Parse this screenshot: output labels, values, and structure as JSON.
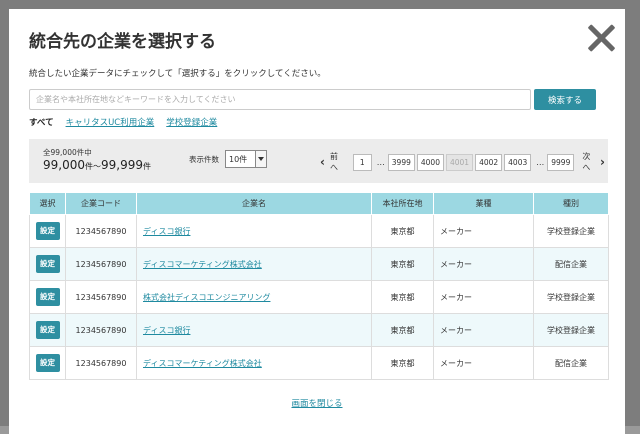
{
  "modal": {
    "title": "統合先の企業を選択する",
    "description": "統合したい企業データにチェックして「選択する」をクリックしてください。",
    "search": {
      "placeholder": "企業名や本社所在地などキーワードを入力してください",
      "button_label": "検索する"
    },
    "filters": {
      "all": "すべて",
      "careertasu": "キャリタスUC利用企業",
      "school": "学校登録企業"
    },
    "summary": {
      "total_label": "全99,000件中",
      "range_start": "99,000",
      "range_start_unit": "件～",
      "range_end": "99,999",
      "range_end_unit": "件",
      "per_page_label": "表示件数",
      "per_page_value": "10件"
    },
    "pager": {
      "prev_icon": "chevron-left-icon",
      "prev_label": "前へ",
      "first": "1",
      "ellipsis": "…",
      "pages": [
        "3999",
        "4000",
        "4001",
        "4002",
        "4003"
      ],
      "current": "4001",
      "last": "9999",
      "next_label": "次へ",
      "next_icon": "chevron-right-icon"
    },
    "table": {
      "headers": [
        "選択",
        "企業コード",
        "企業名",
        "本社所在地",
        "業種",
        "種別"
      ],
      "set_label": "設定",
      "rows": [
        {
          "code": "1234567890",
          "name": "ディスコ銀行",
          "location": "東京都",
          "industry": "メーカー",
          "type": "学校登録企業"
        },
        {
          "code": "1234567890",
          "name": "ディスコマーケティング株式会社",
          "location": "東京都",
          "industry": "メーカー",
          "type": "配信企業"
        },
        {
          "code": "1234567890",
          "name": "株式会社ディスコエンジニアリング",
          "location": "東京都",
          "industry": "メーカー",
          "type": "学校登録企業"
        },
        {
          "code": "1234567890",
          "name": "ディスコ銀行",
          "location": "東京都",
          "industry": "メーカー",
          "type": "学校登録企業"
        },
        {
          "code": "1234567890",
          "name": "ディスコマーケティング株式会社",
          "location": "東京都",
          "industry": "メーカー",
          "type": "配信企業"
        }
      ]
    },
    "close_link": "画面を閉じる"
  },
  "colors": {
    "accent": "#2e8fa1",
    "link": "#1f8aa0",
    "table_header": "#9cd8e2",
    "row_alt": "#eef9fb"
  }
}
